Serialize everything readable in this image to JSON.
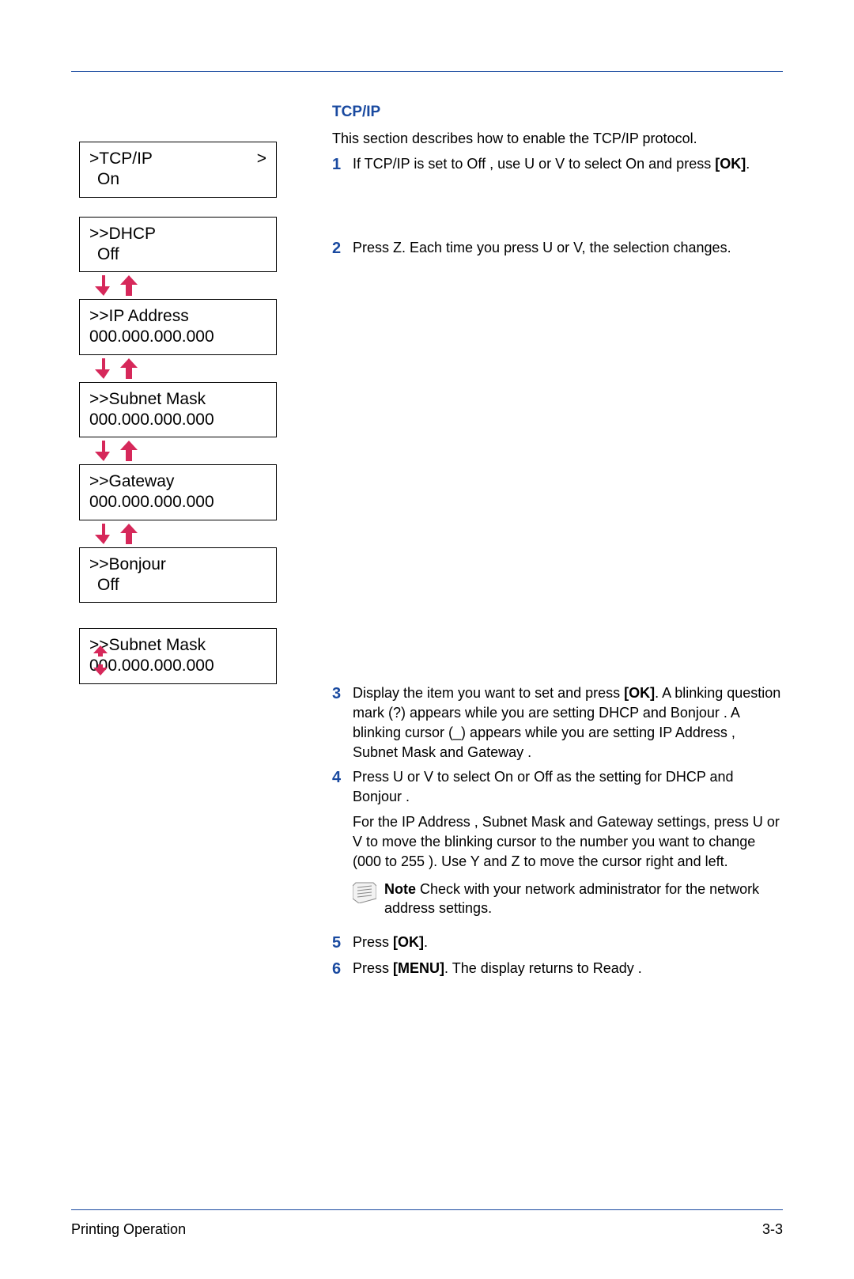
{
  "heading": "TCP/IP",
  "intro": "This section describes how to enable the TCP/IP protocol.",
  "lcd": {
    "tcpip_label": ">TCP/IP",
    "tcpip_right": ">",
    "tcpip_value": "On",
    "dhcp_label": ">>DHCP",
    "dhcp_value": "Off",
    "ip_label": ">>IP Address",
    "ip_value": "000.000.000.000",
    "subnet_label": ">>Subnet Mask",
    "subnet_value": "000.000.000.000",
    "gateway_label": ">>Gateway",
    "gateway_value": "000.000.000.000",
    "bonjour_label": ">>Bonjour",
    "bonjour_value": "Off",
    "subnet_cursor_label": ">>Subnet Mask",
    "subnet_cursor_value": "000.000.000.000"
  },
  "steps": {
    "s1": {
      "num": "1",
      "a": "If TCP/IP  is set to Off , use  U or  V to select On and press ",
      "ok": "[OK]",
      "b": "."
    },
    "s2": {
      "num": "2",
      "text": "Press  Z. Each time you press  U or  V, the selection changes."
    },
    "s3": {
      "num": "3",
      "a": "Display the item you want to set and press ",
      "ok": "[OK]",
      "b": ". A blinking question mark (?) appears while you are setting DHCP and Bonjour  . A blinking cursor (_) appears while you are setting IP Address   , Subnet Mask   and Gateway ."
    },
    "s4": {
      "num": "4",
      "p1": "Press  U or  V to select On or Off  as the setting for DHCP and Bonjour  .",
      "p2": "For the IP Address   , Subnet Mask  and Gateway  settings, press  U or  V to move the blinking cursor to the number you want to change (000 to 255 ). Use  Y and  Z to move the cursor right and left.",
      "note_label": "Note",
      "note_text": "  Check with your network administrator for the network address settings."
    },
    "s5": {
      "num": "5",
      "a": "Press ",
      "ok": "[OK]",
      "b": "."
    },
    "s6": {
      "num": "6",
      "a": "Press ",
      "menu": "[MENU]",
      "b": ". The display returns to Ready ."
    }
  },
  "footer": {
    "left": "Printing Operation",
    "right": "3-3"
  }
}
